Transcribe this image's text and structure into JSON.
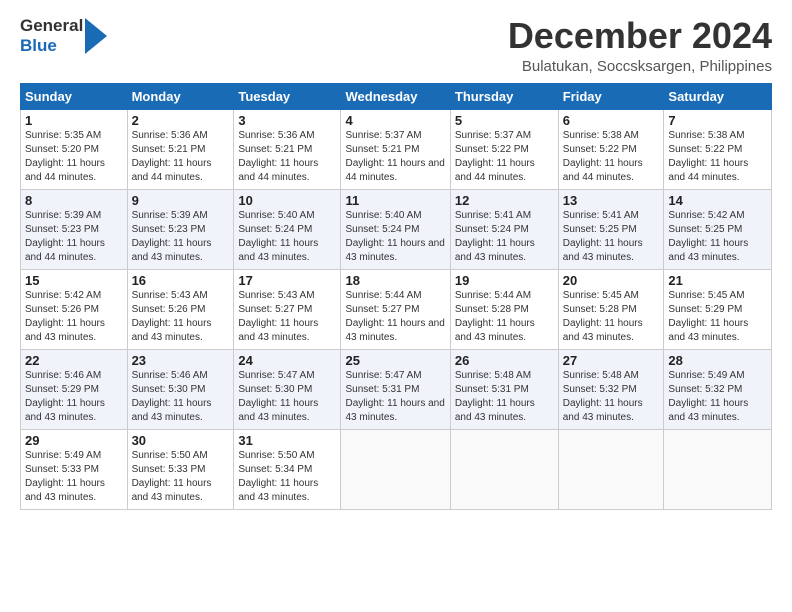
{
  "header": {
    "logo_line1": "General",
    "logo_line2": "Blue",
    "month_title": "December 2024",
    "location": "Bulatukan, Soccsksargen, Philippines"
  },
  "days_of_week": [
    "Sunday",
    "Monday",
    "Tuesday",
    "Wednesday",
    "Thursday",
    "Friday",
    "Saturday"
  ],
  "weeks": [
    [
      {
        "day": "1",
        "info": "Sunrise: 5:35 AM\nSunset: 5:20 PM\nDaylight: 11 hours and 44 minutes."
      },
      {
        "day": "2",
        "info": "Sunrise: 5:36 AM\nSunset: 5:21 PM\nDaylight: 11 hours and 44 minutes."
      },
      {
        "day": "3",
        "info": "Sunrise: 5:36 AM\nSunset: 5:21 PM\nDaylight: 11 hours and 44 minutes."
      },
      {
        "day": "4",
        "info": "Sunrise: 5:37 AM\nSunset: 5:21 PM\nDaylight: 11 hours and 44 minutes."
      },
      {
        "day": "5",
        "info": "Sunrise: 5:37 AM\nSunset: 5:22 PM\nDaylight: 11 hours and 44 minutes."
      },
      {
        "day": "6",
        "info": "Sunrise: 5:38 AM\nSunset: 5:22 PM\nDaylight: 11 hours and 44 minutes."
      },
      {
        "day": "7",
        "info": "Sunrise: 5:38 AM\nSunset: 5:22 PM\nDaylight: 11 hours and 44 minutes."
      }
    ],
    [
      {
        "day": "8",
        "info": "Sunrise: 5:39 AM\nSunset: 5:23 PM\nDaylight: 11 hours and 44 minutes."
      },
      {
        "day": "9",
        "info": "Sunrise: 5:39 AM\nSunset: 5:23 PM\nDaylight: 11 hours and 43 minutes."
      },
      {
        "day": "10",
        "info": "Sunrise: 5:40 AM\nSunset: 5:24 PM\nDaylight: 11 hours and 43 minutes."
      },
      {
        "day": "11",
        "info": "Sunrise: 5:40 AM\nSunset: 5:24 PM\nDaylight: 11 hours and 43 minutes."
      },
      {
        "day": "12",
        "info": "Sunrise: 5:41 AM\nSunset: 5:24 PM\nDaylight: 11 hours and 43 minutes."
      },
      {
        "day": "13",
        "info": "Sunrise: 5:41 AM\nSunset: 5:25 PM\nDaylight: 11 hours and 43 minutes."
      },
      {
        "day": "14",
        "info": "Sunrise: 5:42 AM\nSunset: 5:25 PM\nDaylight: 11 hours and 43 minutes."
      }
    ],
    [
      {
        "day": "15",
        "info": "Sunrise: 5:42 AM\nSunset: 5:26 PM\nDaylight: 11 hours and 43 minutes."
      },
      {
        "day": "16",
        "info": "Sunrise: 5:43 AM\nSunset: 5:26 PM\nDaylight: 11 hours and 43 minutes."
      },
      {
        "day": "17",
        "info": "Sunrise: 5:43 AM\nSunset: 5:27 PM\nDaylight: 11 hours and 43 minutes."
      },
      {
        "day": "18",
        "info": "Sunrise: 5:44 AM\nSunset: 5:27 PM\nDaylight: 11 hours and 43 minutes."
      },
      {
        "day": "19",
        "info": "Sunrise: 5:44 AM\nSunset: 5:28 PM\nDaylight: 11 hours and 43 minutes."
      },
      {
        "day": "20",
        "info": "Sunrise: 5:45 AM\nSunset: 5:28 PM\nDaylight: 11 hours and 43 minutes."
      },
      {
        "day": "21",
        "info": "Sunrise: 5:45 AM\nSunset: 5:29 PM\nDaylight: 11 hours and 43 minutes."
      }
    ],
    [
      {
        "day": "22",
        "info": "Sunrise: 5:46 AM\nSunset: 5:29 PM\nDaylight: 11 hours and 43 minutes."
      },
      {
        "day": "23",
        "info": "Sunrise: 5:46 AM\nSunset: 5:30 PM\nDaylight: 11 hours and 43 minutes."
      },
      {
        "day": "24",
        "info": "Sunrise: 5:47 AM\nSunset: 5:30 PM\nDaylight: 11 hours and 43 minutes."
      },
      {
        "day": "25",
        "info": "Sunrise: 5:47 AM\nSunset: 5:31 PM\nDaylight: 11 hours and 43 minutes."
      },
      {
        "day": "26",
        "info": "Sunrise: 5:48 AM\nSunset: 5:31 PM\nDaylight: 11 hours and 43 minutes."
      },
      {
        "day": "27",
        "info": "Sunrise: 5:48 AM\nSunset: 5:32 PM\nDaylight: 11 hours and 43 minutes."
      },
      {
        "day": "28",
        "info": "Sunrise: 5:49 AM\nSunset: 5:32 PM\nDaylight: 11 hours and 43 minutes."
      }
    ],
    [
      {
        "day": "29",
        "info": "Sunrise: 5:49 AM\nSunset: 5:33 PM\nDaylight: 11 hours and 43 minutes."
      },
      {
        "day": "30",
        "info": "Sunrise: 5:50 AM\nSunset: 5:33 PM\nDaylight: 11 hours and 43 minutes."
      },
      {
        "day": "31",
        "info": "Sunrise: 5:50 AM\nSunset: 5:34 PM\nDaylight: 11 hours and 43 minutes."
      },
      null,
      null,
      null,
      null
    ]
  ]
}
